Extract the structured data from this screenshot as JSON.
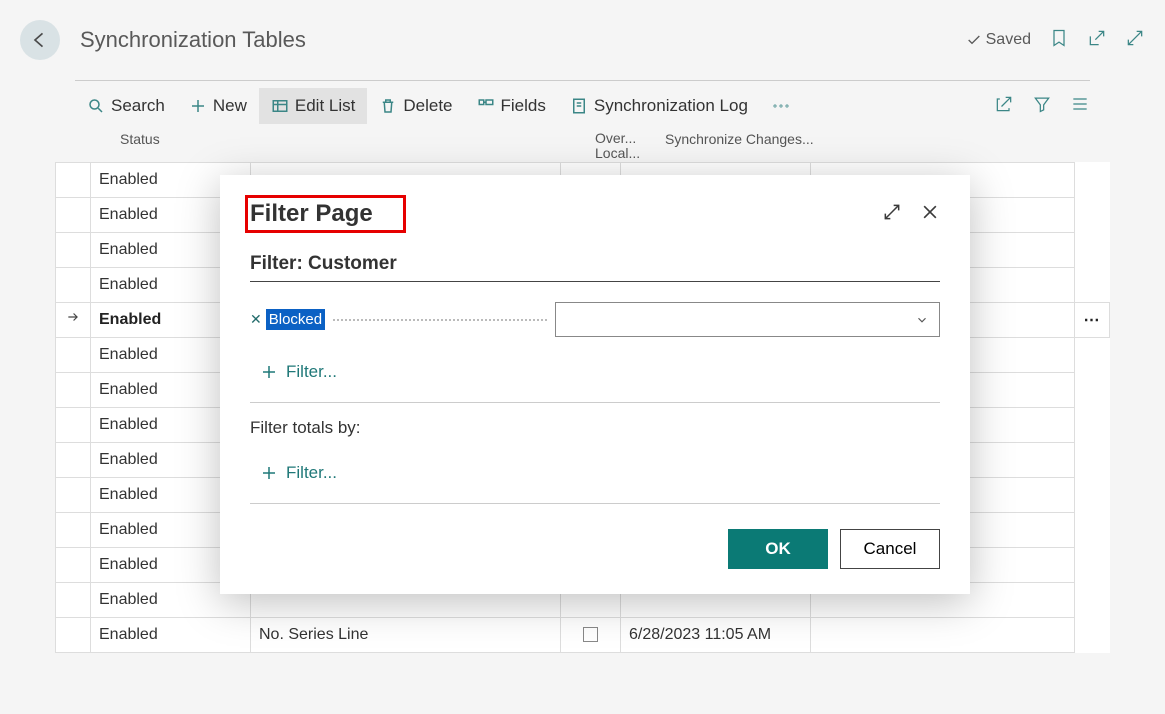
{
  "header": {
    "title": "Synchronization Tables",
    "saved": "Saved"
  },
  "toolbar": {
    "search": "Search",
    "new": "New",
    "edit_list": "Edit List",
    "delete": "Delete",
    "fields": "Fields",
    "sync_log": "Synchronization Log"
  },
  "columns": {
    "status": "Status",
    "over1": "Over...",
    "over2": "Local...",
    "sync": "Synchronize Changes..."
  },
  "rows": [
    {
      "status": "Enabled"
    },
    {
      "status": "Enabled"
    },
    {
      "status": "Enabled"
    },
    {
      "status": "Enabled"
    },
    {
      "status": "Enabled",
      "current": true
    },
    {
      "status": "Enabled"
    },
    {
      "status": "Enabled"
    },
    {
      "status": "Enabled"
    },
    {
      "status": "Enabled"
    },
    {
      "status": "Enabled"
    },
    {
      "status": "Enabled"
    },
    {
      "status": "Enabled"
    },
    {
      "status": "Enabled"
    },
    {
      "status": "Enabled",
      "name": "No. Series Line",
      "sync": "6/28/2023 11:05 AM"
    }
  ],
  "modal": {
    "title": "Filter Page",
    "filter_title": "Filter: Customer",
    "field_label": "Blocked",
    "add_filter": "Filter...",
    "totals_label": "Filter totals by:",
    "ok": "OK",
    "cancel": "Cancel"
  }
}
